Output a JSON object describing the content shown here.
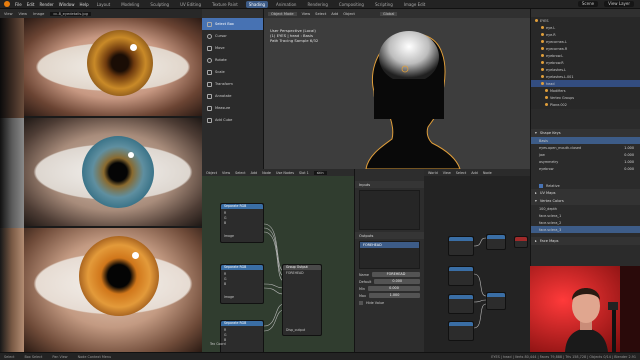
{
  "topbar": {
    "menus": [
      "File",
      "Edit",
      "Render",
      "Window",
      "Help"
    ],
    "tabs": [
      "Layout",
      "Modeling",
      "Sculpting",
      "UV Editing",
      "Texture Paint",
      "Shading",
      "Animation",
      "Rendering",
      "Compositing",
      "Scripting",
      "Image Edit"
    ],
    "active_tab": "Shading",
    "scene_label": "Scene",
    "view_layer_label": "View Layer"
  },
  "image_viewer": {
    "header_items": [
      "View",
      "View",
      "Image",
      "cc-8_eyedetails.jpg"
    ]
  },
  "toolbar": {
    "tools": [
      "Select Box",
      "Cursor",
      "Move",
      "Rotate",
      "Scale",
      "Transform",
      "Annotate",
      "Measure",
      "Add Cube"
    ],
    "active_tool": "Select Box"
  },
  "viewport": {
    "header_items": [
      "Object Mode",
      "View",
      "Select",
      "Add",
      "Object",
      "Global"
    ],
    "info_line1": "User Perspective (Local)",
    "info_line2": "(1) EYES | head : Basis",
    "info_line3": "Path Tracing Sample 6/32"
  },
  "outliner": {
    "rows": [
      {
        "label": "EYES",
        "selected": false
      },
      {
        "label": "eye.L",
        "selected": false
      },
      {
        "label": "eye.R",
        "selected": false
      },
      {
        "label": "eyecornea.L",
        "selected": false
      },
      {
        "label": "eyecornea.R",
        "selected": false
      },
      {
        "label": "eyebrow.L",
        "selected": false
      },
      {
        "label": "eyebrow.R",
        "selected": false
      },
      {
        "label": "eyelashes.L",
        "selected": false
      },
      {
        "label": "eyelashes.L.001",
        "selected": false
      },
      {
        "label": "head",
        "selected": true
      },
      {
        "label": "Modifiers",
        "selected": false
      },
      {
        "label": "Vertex Groups",
        "selected": false
      },
      {
        "label": "Plane.002",
        "selected": false
      }
    ]
  },
  "properties": {
    "shape_keys_title": "Shape Keys",
    "shape_keys": [
      {
        "name": "Basis",
        "value": ""
      },
      {
        "name": "eyes.open_mouth.closed",
        "value": "1.000"
      },
      {
        "name": "jaw",
        "value": "0.000"
      },
      {
        "name": "asymmetry",
        "value": "1.000"
      },
      {
        "name": "eyebrow",
        "value": "0.000"
      }
    ],
    "relative_label": "Relative",
    "uv_maps_title": "UV Maps",
    "vertex_colors_title": "Vertex Colors",
    "vertex_colors": [
      "100_depth",
      "face.sclera_1",
      "face.sclera_2",
      "face.sclera_3"
    ],
    "face_maps_title": "Face Maps"
  },
  "node_editor": {
    "header_items": [
      "Object",
      "View",
      "Select",
      "Add",
      "Node",
      "Use Nodes",
      "Slot 1",
      "skin"
    ],
    "nodes": [
      {
        "title": "Separate RGB",
        "out": "Image"
      },
      {
        "title": "Separate RGB",
        "out": "Image"
      },
      {
        "title": "Separate RGB",
        "out": "Image"
      }
    ],
    "group_output_title": "Group Output",
    "group_output_label": "FOREHEAD",
    "group_input_label": "Tex Coord",
    "group_output_footer": "Disp_output"
  },
  "node_sidebar": {
    "inputs_title": "Inputs",
    "outputs_title": "Outputs",
    "output_item": "FOREHEAD",
    "name_label": "Name",
    "name_value": "FOREHEAD",
    "default_label": "Default",
    "default_value": "0.000",
    "min_label": "Min",
    "min_value": "0.000",
    "max_label": "Max",
    "max_value": "1.000",
    "hide_value_label": "Hide Value"
  },
  "node_editor2": {
    "header_items": [
      "World",
      "View",
      "Select",
      "Add",
      "Node"
    ]
  },
  "statusbar": {
    "left_items": [
      "Select",
      "Box Select",
      "Pan View",
      "Node Context Menu"
    ],
    "right_text": "EYES | head | Verts 80,444 | Faces 79,888 | Tris 158,728 | Objects 0/14 | Blender 2.91"
  },
  "colors": {
    "accent": "#4772b3",
    "node_header_blue": "#3a6ea5",
    "head_outline": "#e09e3a",
    "node_bg": "#303d2f"
  }
}
